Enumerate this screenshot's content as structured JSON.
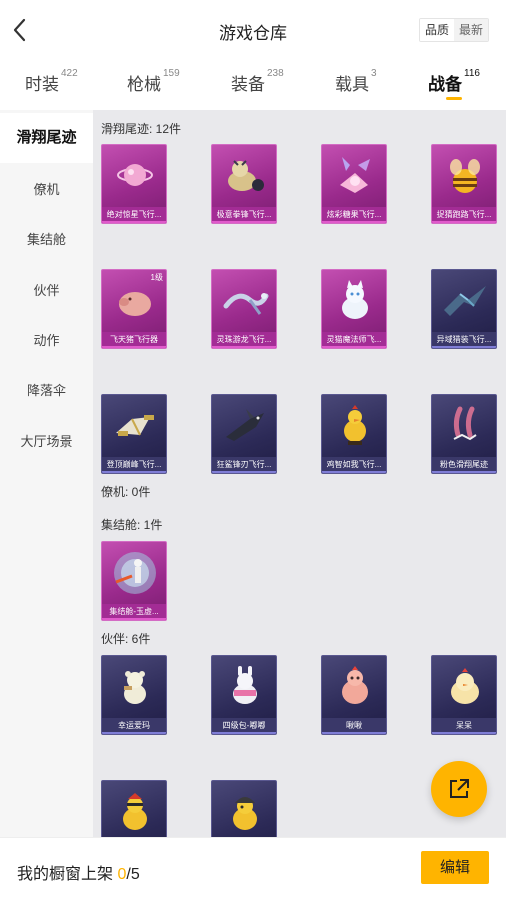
{
  "header": {
    "title": "游戏仓库",
    "sort_quality": "品质",
    "sort_latest": "最新"
  },
  "tabs": [
    {
      "label": "时装",
      "count": "422"
    },
    {
      "label": "枪械",
      "count": "159"
    },
    {
      "label": "装备",
      "count": "238"
    },
    {
      "label": "载具",
      "count": "3"
    },
    {
      "label": "战备",
      "count": "116"
    }
  ],
  "sidebar": [
    "滑翔尾迹",
    "僚机",
    "集结舱",
    "伙伴",
    "动作",
    "降落伞",
    "大厅场景"
  ],
  "sections": {
    "glide_trail": {
      "title": "滑翔尾迹: 12件"
    },
    "wingman": {
      "title": "僚机: 0件"
    },
    "rally_pod": {
      "title": "集结舱: 1件"
    },
    "partner": {
      "title": "伙伴: 6件"
    }
  },
  "items": {
    "glide": [
      {
        "name": "绝对惊星飞行...",
        "rarity": "pink"
      },
      {
        "name": "极意拳锋飞行...",
        "rarity": "pink"
      },
      {
        "name": "炫彩糖果飞行...",
        "rarity": "pink"
      },
      {
        "name": "捉猜跑路飞行...",
        "rarity": "pink"
      },
      {
        "name": "飞天猪飞行器",
        "rarity": "pink",
        "level": "1级"
      },
      {
        "name": "灵珠游龙飞行...",
        "rarity": "pink"
      },
      {
        "name": "灵猫魔法师飞...",
        "rarity": "pink"
      },
      {
        "name": "异域猎装飞行...",
        "rarity": "navy"
      },
      {
        "name": "登顶巅峰飞行...",
        "rarity": "navy"
      },
      {
        "name": "狂鲨锋刃飞行...",
        "rarity": "navy"
      },
      {
        "name": "鸡智如我飞行...",
        "rarity": "navy"
      },
      {
        "name": "粉色滑翔尾迹",
        "rarity": "navy"
      }
    ],
    "pod": [
      {
        "name": "集结舱-玉虚...",
        "rarity": "pink"
      }
    ],
    "partner": [
      {
        "name": "幸运爱玛",
        "rarity": "navy"
      },
      {
        "name": "四级包-嘟嘟",
        "rarity": "navy"
      },
      {
        "name": "啾啾",
        "rarity": "navy"
      },
      {
        "name": "呆呆",
        "rarity": "navy"
      },
      {
        "name": "",
        "rarity": "navy"
      },
      {
        "name": "",
        "rarity": "navy"
      }
    ]
  },
  "icons": {
    "back": "back-chevron-icon",
    "share": "share-export-icon"
  },
  "colors": {
    "accent": "#ffb400",
    "legendary": "#9a2a8c",
    "epic": "#2c2a57"
  },
  "bottom": {
    "label": "我的橱窗上架",
    "current": "0",
    "sep": "/",
    "total": "5",
    "edit": "编辑"
  }
}
